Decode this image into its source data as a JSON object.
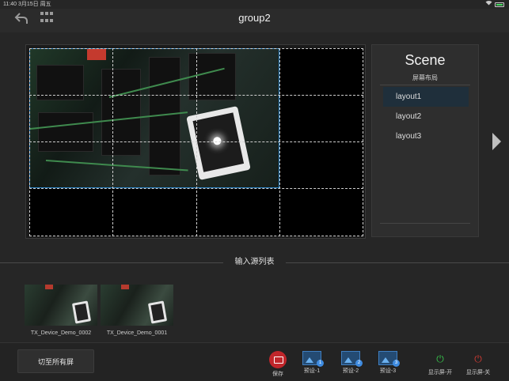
{
  "status_bar": {
    "time": "11:40",
    "date": "3月15日 周五",
    "battery_percent": 25,
    "icons": [
      "wifi-icon",
      "battery-icon"
    ]
  },
  "navbar": {
    "title": "group2",
    "back_icon": "undo-arrow-icon",
    "menu_icon": "grid-menu-icon"
  },
  "stage": {
    "grid_columns": 4,
    "grid_rows": 4
  },
  "scene": {
    "title": "Scene",
    "subtitle": "屏幕布局",
    "layouts": [
      "layout1",
      "layout2",
      "layout3"
    ],
    "selected_layout": "layout1"
  },
  "sources": {
    "header": "输入源列表",
    "items": [
      {
        "name": "TX_Device_Demo_0002"
      },
      {
        "name": "TX_Device_Demo_0001"
      }
    ]
  },
  "toolbar": {
    "switch_all_label": "切至所有屏",
    "save_label": "保存",
    "preset1_label": "预设-1",
    "preset2_label": "预设-2",
    "preset3_label": "预设-3",
    "display_on_label": "显示屏-开",
    "display_off_label": "显示屏-关",
    "preset1_badge": "1",
    "preset2_badge": "2",
    "preset3_badge": "3"
  },
  "colors": {
    "accent": "#2f86c8",
    "save": "#c0262b",
    "power_on": "#37c24b",
    "power_off": "#d03b33"
  }
}
